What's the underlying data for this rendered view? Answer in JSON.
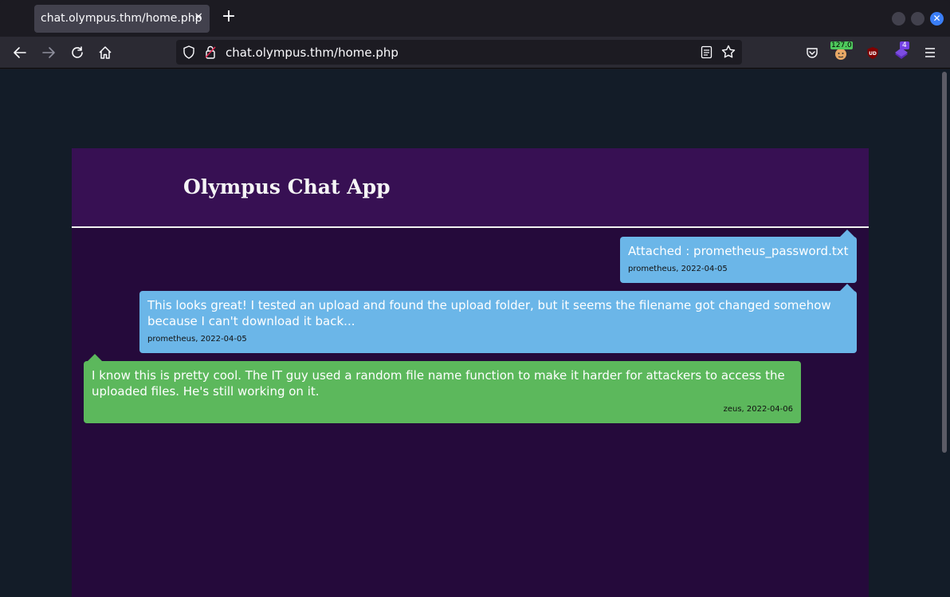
{
  "browser": {
    "tab_title": "chat.olympus.thm/home.php",
    "tab_close": "×",
    "new_tab": "+",
    "url": "chat.olympus.thm/home.php",
    "extensions": {
      "ip_badge": "127.0",
      "purple_badge": "4"
    },
    "icons": [
      "back-icon",
      "forward-icon",
      "reload-icon",
      "home-icon",
      "shield-icon",
      "lock-icon",
      "reader-icon",
      "star-icon",
      "pocket-icon",
      "ublock-icon",
      "menu-icon"
    ]
  },
  "page": {
    "title": "Olympus Chat App",
    "messages": [
      {
        "text": "Attached : prometheus_password.txt",
        "meta": "prometheus, 2022-04-05",
        "side": "right"
      },
      {
        "text": "This looks great! I tested an upload and found the upload folder, but it seems the filename got changed somehow because I can't download it back...",
        "meta": "prometheus, 2022-04-05",
        "side": "right"
      },
      {
        "text": "I know this is pretty cool. The IT guy used a random file name function to make it harder for attackers to access the uploaded files. He's still working on it.",
        "meta": "zeus, 2022-04-06",
        "side": "left"
      }
    ]
  },
  "colors": {
    "panel_bg": "#250a3b",
    "header_bg": "#371053",
    "bubble_blue": "#6bb6e8",
    "bubble_green": "#5cb85c"
  }
}
